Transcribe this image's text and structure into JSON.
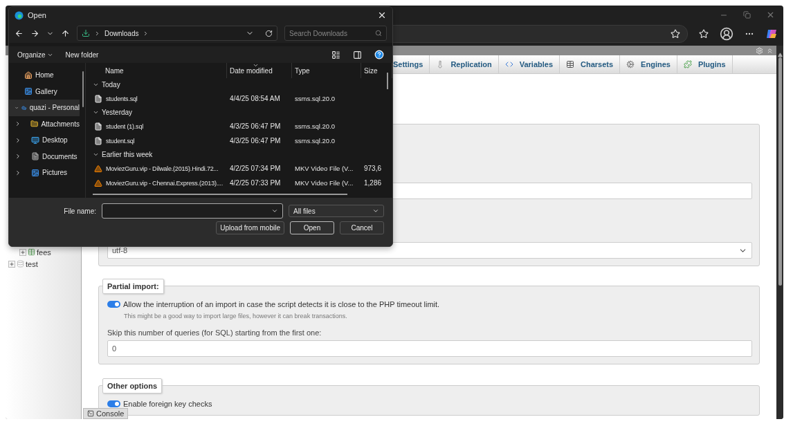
{
  "pma": {
    "tabs": [
      {
        "label": "Settings",
        "selected": false
      },
      {
        "label": "Replication",
        "selected": false
      },
      {
        "label": "Variables",
        "selected": false
      },
      {
        "label": "Charsets",
        "selected": false
      },
      {
        "label": "Engines",
        "selected": false
      },
      {
        "label": "Plugins",
        "selected": false
      }
    ],
    "nav_tree": [
      {
        "label": "fees",
        "kind": "table",
        "expanded": false
      },
      {
        "label": "test",
        "kind": "database",
        "expanded": false
      }
    ],
    "charset_select": "utf-8",
    "partial_import": {
      "legend": "Partial import:",
      "allow_interruption": {
        "label": "Allow the interruption of an import in case the script detects it is close to the PHP timeout limit.",
        "on": true,
        "hint": "This might be a good way to import large files, however it can break transactions."
      },
      "skip_label": "Skip this number of queries (for SQL) starting from the first one:",
      "skip_value": "0"
    },
    "other_options": {
      "legend": "Other options",
      "foreign_key_checks": {
        "label": "Enable foreign key checks",
        "on": true
      }
    },
    "console": "Console"
  },
  "dialog": {
    "title": "Open",
    "breadcrumb": [
      "Downloads"
    ],
    "search": {
      "placeholder": "Search Downloads"
    },
    "commands": [
      "Organize",
      "New folder"
    ],
    "sidebar": [
      {
        "label": "Home",
        "kind": "home",
        "selected": false
      },
      {
        "label": "Gallery",
        "kind": "gallery",
        "selected": false
      },
      {
        "label": "quazi - Personal",
        "kind": "cloud",
        "selected": true,
        "expanded": true,
        "children": [
          {
            "label": "Attachments",
            "kind": "folder",
            "selected": false,
            "expanded": false
          },
          {
            "label": "Desktop",
            "kind": "desktop",
            "selected": false,
            "expanded": false
          },
          {
            "label": "Documents",
            "kind": "documents",
            "selected": false,
            "expanded": false
          },
          {
            "label": "Pictures",
            "kind": "pictures",
            "selected": false,
            "expanded": false
          }
        ]
      }
    ],
    "columns": [
      {
        "label": "Name",
        "sorted": false
      },
      {
        "label": "Date modified",
        "sorted": true
      },
      {
        "label": "Type",
        "sorted": false
      },
      {
        "label": "Size",
        "sorted": false
      }
    ],
    "groups": [
      {
        "label": "Today",
        "expanded": true,
        "files": [
          {
            "name": "students.sql",
            "kind": "document",
            "date": "4/4/25 08:54 AM",
            "type": "ssms.sql.20.0"
          }
        ]
      },
      {
        "label": "Yesterday",
        "expanded": true,
        "files": [
          {
            "name": "student (1).sql",
            "kind": "document",
            "date": "4/3/25 06:47 PM",
            "type": "ssms.sql.20.0"
          },
          {
            "name": "student.sql",
            "kind": "document",
            "date": "4/3/25 06:47 PM",
            "type": "ssms.sql.20.0"
          }
        ]
      },
      {
        "label": "Earlier this week",
        "expanded": true,
        "files": [
          {
            "name": "MoviezGuru.vip - Dilwale.(2015).Hindi.72...",
            "kind": "video",
            "date": "4/2/25 07:34 PM",
            "type": "MKV Video File (V...",
            "size": "973,6"
          },
          {
            "name": "MoviezGuru.vip - Chennai.Express.(2013)....",
            "kind": "video",
            "date": "4/2/25 07:33 PM",
            "type": "MKV Video File (V...",
            "size": "1,286"
          }
        ]
      }
    ],
    "file_name_label": "File name:",
    "file_type": "All files",
    "buttons": [
      {
        "label": "Upload from mobile",
        "default": false
      },
      {
        "label": "Open",
        "default": true
      },
      {
        "label": "Cancel",
        "default": false
      }
    ]
  }
}
